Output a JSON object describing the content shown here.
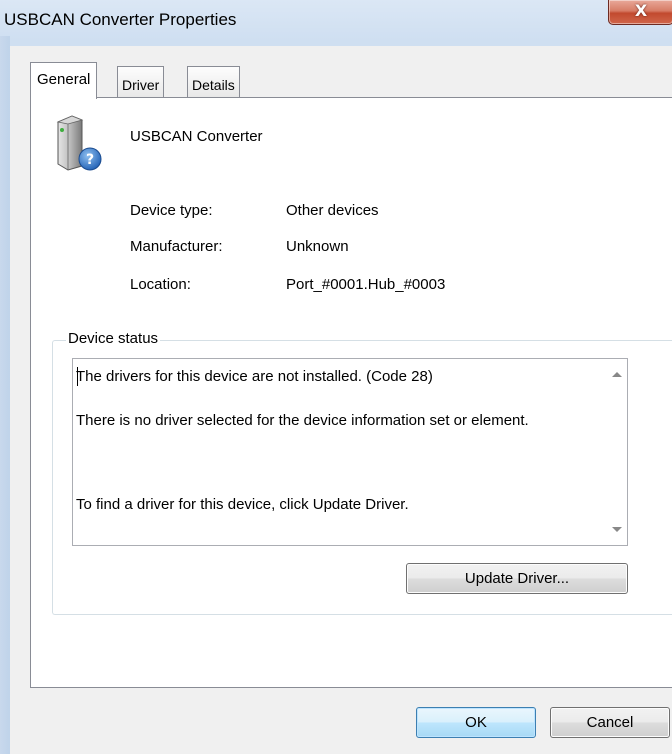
{
  "window": {
    "title": "USBCAN Converter Properties",
    "close_glyph": "X"
  },
  "tabs": [
    {
      "label": "General",
      "active": true
    },
    {
      "label": "Driver",
      "active": false
    },
    {
      "label": "Details",
      "active": false
    }
  ],
  "device": {
    "name": "USBCAN Converter",
    "icon": "unknown-device-icon",
    "properties": [
      {
        "label": "Device type:",
        "value": "Other devices"
      },
      {
        "label": "Manufacturer:",
        "value": "Unknown"
      },
      {
        "label": "Location:",
        "value": "Port_#0001.Hub_#0003"
      }
    ]
  },
  "status": {
    "group_label": "Device status",
    "lines": [
      "The drivers for this device are not installed. (Code 28)",
      "There is no driver selected for the device information set or element.",
      "To find a driver for this device, click Update Driver."
    ],
    "update_button": "Update Driver..."
  },
  "footer": {
    "ok": "OK",
    "cancel": "Cancel"
  },
  "colors": {
    "close_button": "#c94a2f",
    "default_button_border": "#3c7fb1"
  }
}
